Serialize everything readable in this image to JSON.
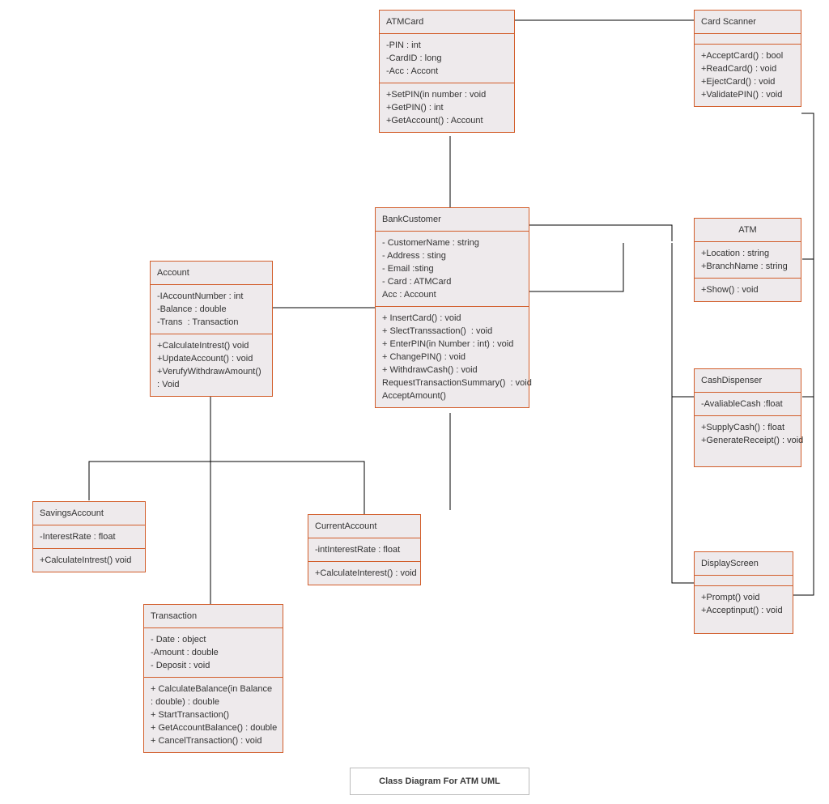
{
  "caption": "Class Diagram For ATM UML",
  "classes": {
    "atmcard": {
      "name": "ATMCard",
      "attrs": [
        "-PIN : int",
        "-CardID : long",
        "-Acc : Accont"
      ],
      "ops": [
        "+SetPIN(in number : void",
        "+GetPIN() : int",
        "+GetAccount() : Account"
      ]
    },
    "cardscanner": {
      "name": "Card Scanner",
      "attrs": [],
      "ops": [
        "+AcceptCard() : bool",
        "+ReadCard() : void",
        "+EjectCard() : void",
        "+ValidatePIN() : void"
      ]
    },
    "bankcustomer": {
      "name": "BankCustomer",
      "attrs": [
        "- CustomerName : string",
        "- Address : sting",
        "- Email :sting",
        "- Card : ATMCard",
        "Acc : Account"
      ],
      "ops": [
        "+ InsertCard() : void",
        "+ SlectTranssaction()  : void",
        "+ EnterPIN(in Number : int) : void",
        "+ ChangePIN() : void",
        "+ WithdrawCash() : void",
        "RequestTransactionSummary()  : void",
        "AcceptAmount()"
      ]
    },
    "atm": {
      "name": "ATM",
      "attrs": [
        "+Location : string",
        "+BranchName : string"
      ],
      "ops": [
        "+Show() : void"
      ]
    },
    "account": {
      "name": "Account",
      "attrs": [
        "-IAccountNumber : int",
        "-Balance : double",
        "-Trans  : Transaction"
      ],
      "ops": [
        "+CalculateIntrest() void",
        "+UpdateAccount() : void",
        "+VerufyWithdrawAmount() : Void"
      ]
    },
    "cashdispenser": {
      "name": "CashDispenser",
      "attrs": [
        "-AvaliableCash :float"
      ],
      "ops": [
        "+SupplyCash() : float",
        "+GenerateReceipt() : void"
      ]
    },
    "savings": {
      "name": "SavingsAccount",
      "attrs": [
        "-InterestRate : float"
      ],
      "ops": [
        "+CalculateIntrest() void"
      ]
    },
    "current": {
      "name": "CurrentAccount",
      "attrs": [
        "-intInterestRate : float"
      ],
      "ops": [
        "+CalculateInterest() : void"
      ]
    },
    "displayscreen": {
      "name": "DisplayScreen",
      "attrs": [],
      "ops": [
        "+Prompt() void",
        "+Acceptinput() : void"
      ]
    },
    "transaction": {
      "name": "Transaction",
      "attrs": [
        "- Date : object",
        "-Amount : double",
        "- Deposit : void"
      ],
      "ops": [
        "+ CalculateBalance(in Balance : double) : double",
        "+ StartTransaction()",
        "+ GetAccountBalance() : double",
        "+ CancelTransaction() : void"
      ]
    }
  }
}
